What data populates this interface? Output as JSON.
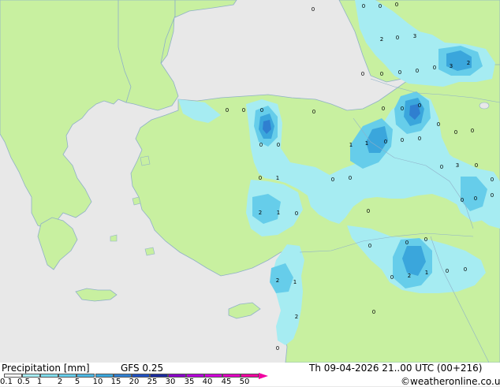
{
  "map": {
    "colors": {
      "sea": "#e8e8e8",
      "land": "#c8f0a0",
      "coast": "#8fb0c8",
      "precip_light": "#a6ecf2",
      "precip_mid": "#66cdea",
      "precip_high": "#3aa6dc",
      "precip_peak": "#2f7fd0"
    },
    "point_labels": [
      "0",
      "0",
      "0",
      "0",
      "2",
      "0",
      "3",
      "0",
      "0",
      "0",
      "0",
      "0",
      "3",
      "2",
      "0",
      "0",
      "0",
      "0",
      "0",
      "0",
      "0",
      "0",
      "0",
      "0",
      "0",
      "0",
      "1",
      "1",
      "0",
      "0",
      "0",
      "3",
      "0",
      "0",
      "0",
      "0",
      "1",
      "0",
      "0",
      "0",
      "0",
      "1",
      "2",
      "0",
      "0",
      "0",
      "0",
      "0",
      "0",
      "2",
      "1",
      "0",
      "0",
      "0",
      "2",
      "1",
      "2",
      "0",
      "0"
    ]
  },
  "footer": {
    "title": "Precipitation [mm]",
    "model": "GFS 0.25",
    "datetime": "Th 09-04-2026 21..00 UTC (00+216)",
    "credit": "©weatheronline.co.uk"
  },
  "legend": {
    "labels": [
      "0.1",
      "0.5",
      "1",
      "2",
      "5",
      "10",
      "15",
      "20",
      "25",
      "30",
      "35",
      "40",
      "45",
      "50"
    ],
    "colors": [
      "#ffffff",
      "#a6ecf2",
      "#80dcec",
      "#66cdea",
      "#4cb8e4",
      "#3aa6dc",
      "#2f7fd0",
      "#2050c0",
      "#1a2a9c",
      "#8a00c8",
      "#b400d8",
      "#d000d8",
      "#e000c0",
      "#f000a0"
    ]
  }
}
